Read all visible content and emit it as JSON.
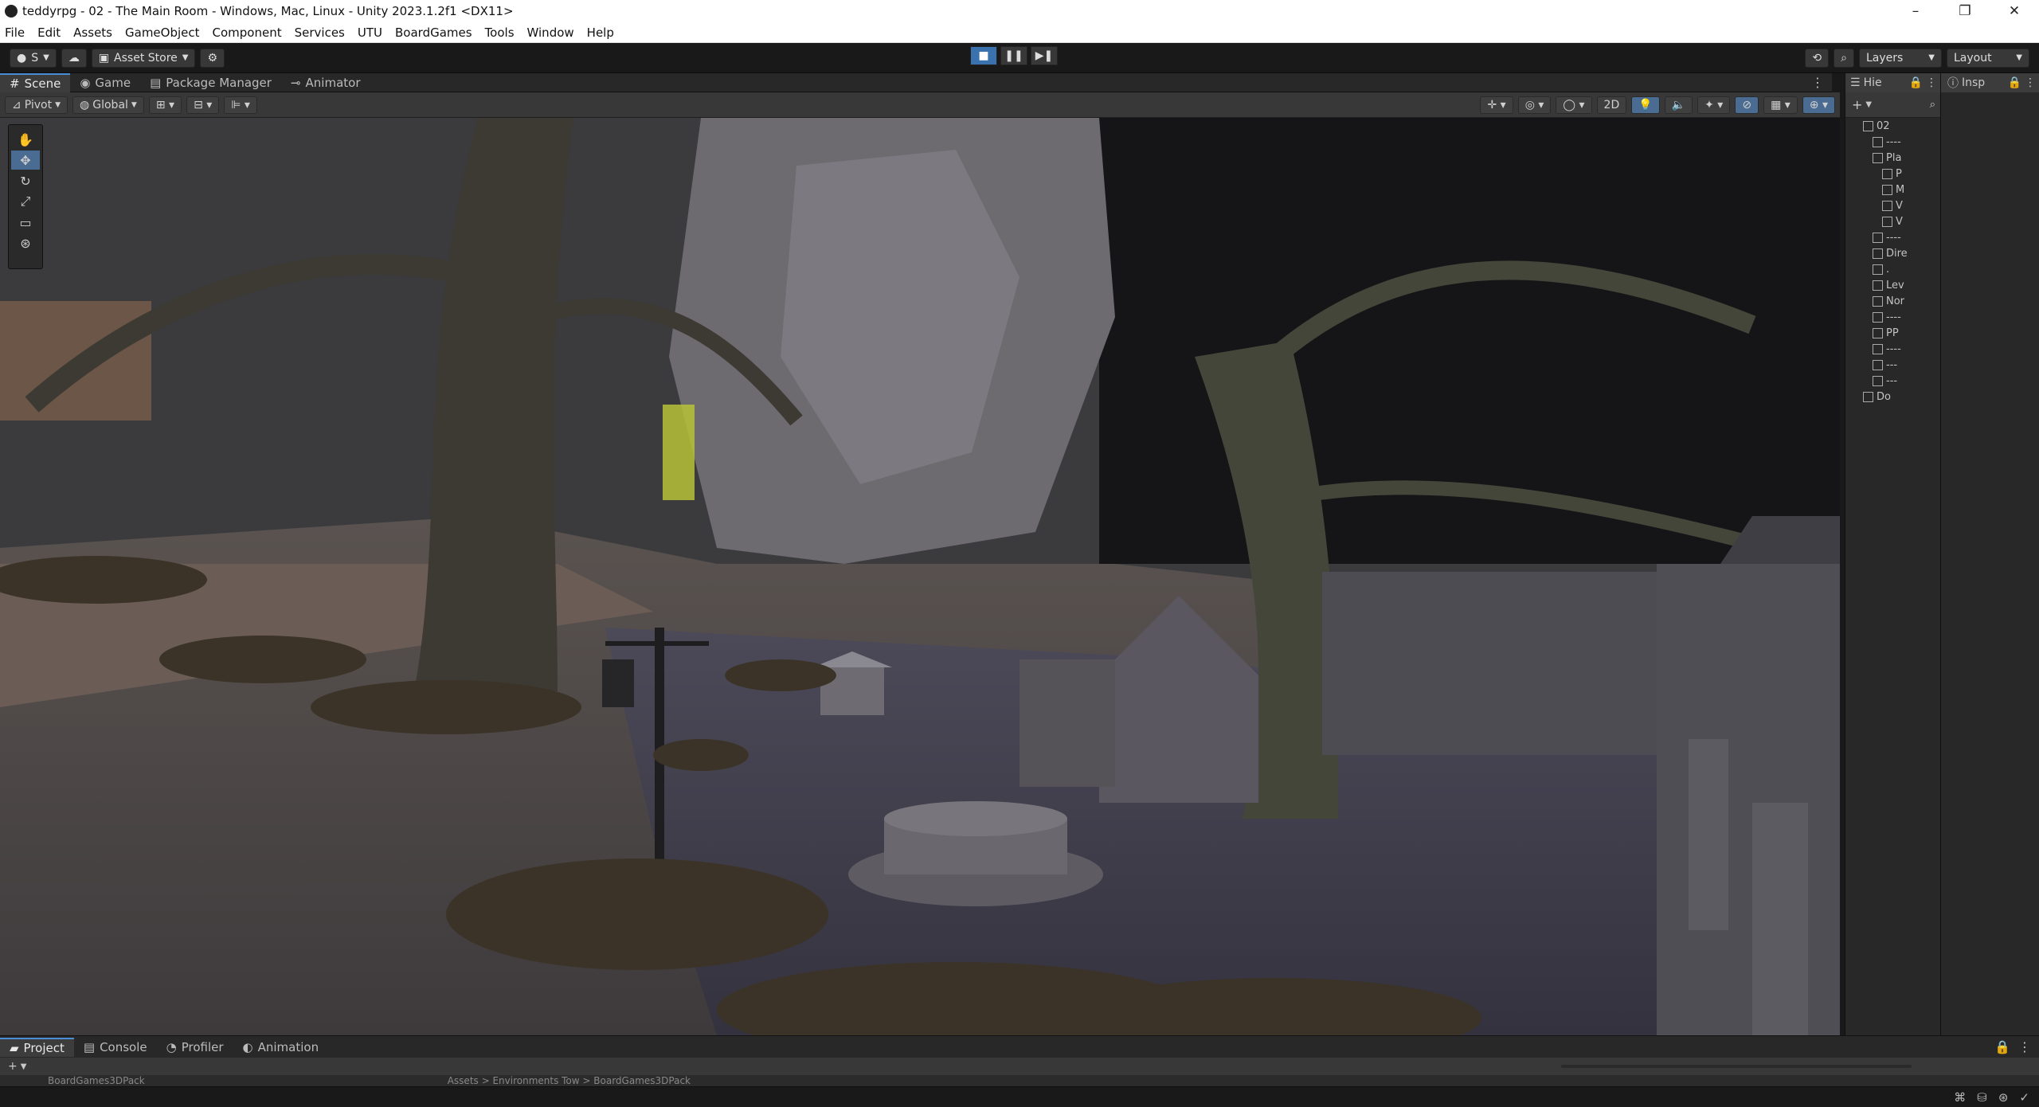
{
  "window": {
    "title": "teddyrpg - 02 - The Main Room - Windows, Mac, Linux - Unity 2023.1.2f1 <DX11>",
    "controls": [
      "–",
      "❐",
      "✕"
    ]
  },
  "menu": [
    "File",
    "Edit",
    "Assets",
    "GameObject",
    "Component",
    "Services",
    "UTU",
    "BoardGames",
    "Tools",
    "Window",
    "Help"
  ],
  "toolbar": {
    "account_label": "S",
    "asset_store_label": "Asset Store",
    "layers_label": "Layers",
    "layout_label": "Layout"
  },
  "tabs": [
    {
      "label": "Scene",
      "icon": "grid-icon",
      "active": true
    },
    {
      "label": "Game",
      "icon": "gamepad-icon",
      "active": false
    },
    {
      "label": "Package Manager",
      "icon": "package-icon",
      "active": false
    },
    {
      "label": "Animator",
      "icon": "animator-icon",
      "active": false
    }
  ],
  "scene_toolbar": {
    "pivot_label": "Pivot",
    "global_label": "Global",
    "mode_2d": "2D"
  },
  "hierarchy": {
    "tab_label": "Hie",
    "items": [
      {
        "label": "02",
        "indent": 0,
        "type": "scene"
      },
      {
        "label": "----",
        "indent": 1,
        "type": "object"
      },
      {
        "label": "Pla",
        "indent": 1,
        "type": "object"
      },
      {
        "label": "P",
        "indent": 2,
        "type": "object"
      },
      {
        "label": "M",
        "indent": 2,
        "type": "object"
      },
      {
        "label": "V",
        "indent": 2,
        "type": "object"
      },
      {
        "label": "V",
        "indent": 2,
        "type": "object"
      },
      {
        "label": "----",
        "indent": 1,
        "type": "object"
      },
      {
        "label": "Dire",
        "indent": 1,
        "type": "object"
      },
      {
        "label": ".",
        "indent": 1,
        "type": "object"
      },
      {
        "label": "Lev",
        "indent": 1,
        "type": "object"
      },
      {
        "label": "Nor",
        "indent": 1,
        "type": "object"
      },
      {
        "label": "----",
        "indent": 1,
        "type": "object"
      },
      {
        "label": "PP",
        "indent": 1,
        "type": "object"
      },
      {
        "label": "----",
        "indent": 1,
        "type": "object"
      },
      {
        "label": "---",
        "indent": 1,
        "type": "object"
      },
      {
        "label": "---",
        "indent": 1,
        "type": "object"
      },
      {
        "label": "Do",
        "indent": 0,
        "type": "scene"
      }
    ]
  },
  "inspector": {
    "tab_label": "Insp"
  },
  "bottom_tabs": [
    {
      "label": "Project",
      "icon": "folder-icon",
      "active": true
    },
    {
      "label": "Console",
      "icon": "console-icon",
      "active": false
    },
    {
      "label": "Profiler",
      "icon": "profiler-icon",
      "active": false
    },
    {
      "label": "Animation",
      "icon": "animation-icon",
      "active": false
    }
  ],
  "project": {
    "folder_partial": "BoardGames3DPack",
    "breadcrumb_partial": "Assets > Environments Tow > BoardGames3DPack"
  },
  "colors": {
    "accent": "#4a8fd6",
    "play_active": "#3a72b0"
  }
}
